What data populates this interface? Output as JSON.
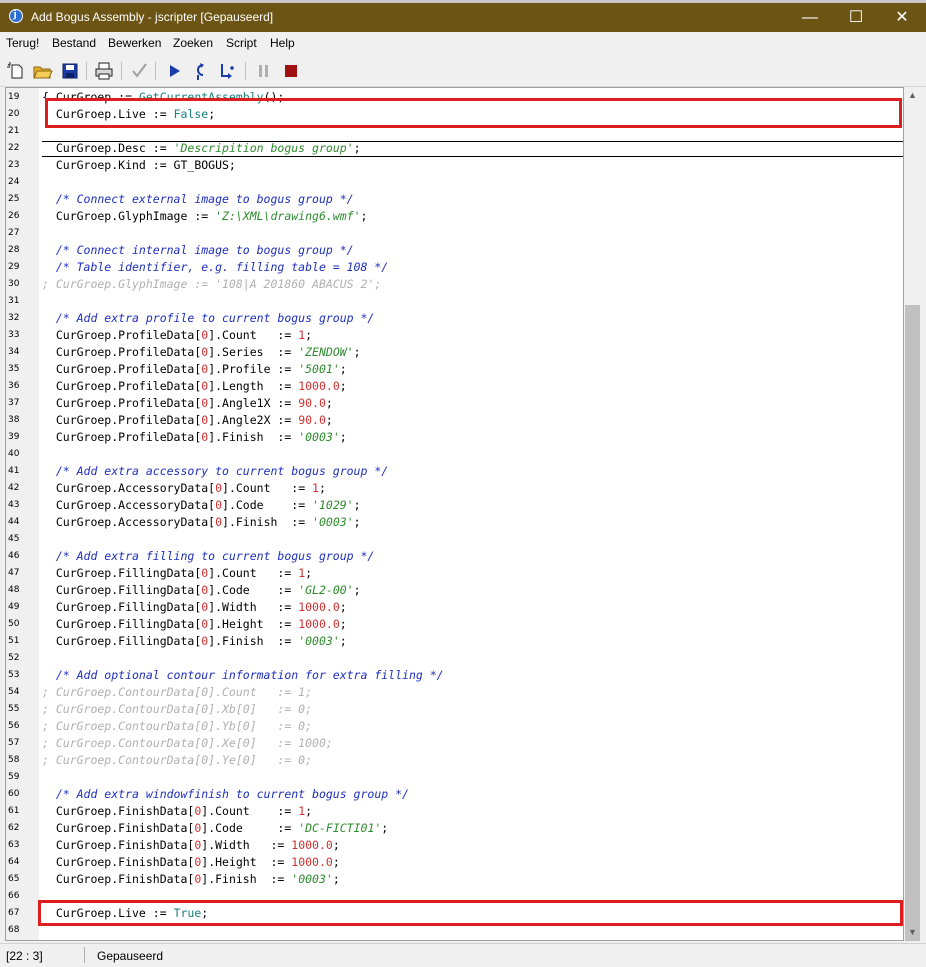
{
  "window": {
    "title": "Add Bogus Assembly - jscripter [Gepauseerd]",
    "minimize": "—",
    "maximize": "☐",
    "close": "✕"
  },
  "menu": [
    "Terug!",
    "Bestand",
    "Bewerken",
    "Zoeken",
    "Script",
    "Help"
  ],
  "toolbar": {
    "icons": [
      "new-file-icon",
      "open-folder-icon",
      "save-icon",
      "print-icon",
      "check-icon",
      "run-icon",
      "step-into-icon",
      "step-over-icon",
      "pause-icon",
      "stop-icon"
    ]
  },
  "editor": {
    "lines": [
      {
        "n": "19",
        "code": "{ CurGroep := GetCurrentAssembly();"
      },
      {
        "n": "20",
        "code": "  CurGroep.Live := False;"
      },
      {
        "n": "21",
        "code": ""
      },
      {
        "n": "22",
        "code": "  CurGroep.Desc := 'Descripition bogus group';"
      },
      {
        "n": "23",
        "code": "  CurGroep.Kind := GT_BOGUS;"
      },
      {
        "n": "24",
        "code": ""
      },
      {
        "n": "25",
        "code": "  /* Connect external image to bogus group */"
      },
      {
        "n": "26",
        "code": "  CurGroep.GlyphImage := 'Z:\\XML\\drawing6.wmf';"
      },
      {
        "n": "27",
        "code": ""
      },
      {
        "n": "28",
        "code": "  /* Connect internal image to bogus group */"
      },
      {
        "n": "29",
        "code": "  /* Table identifier, e.g. filling table = 108 */"
      },
      {
        "n": "30",
        "code": "; CurGroep.GlyphImage := '108|A 201860 ABACUS 2';"
      },
      {
        "n": "31",
        "code": ""
      },
      {
        "n": "32",
        "code": "  /* Add extra profile to current bogus group */"
      },
      {
        "n": "33",
        "code": "  CurGroep.ProfileData[0].Count   := 1;"
      },
      {
        "n": "34",
        "code": "  CurGroep.ProfileData[0].Series  := 'ZENDOW';"
      },
      {
        "n": "35",
        "code": "  CurGroep.ProfileData[0].Profile := '5001';"
      },
      {
        "n": "36",
        "code": "  CurGroep.ProfileData[0].Length  := 1000.0;"
      },
      {
        "n": "37",
        "code": "  CurGroep.ProfileData[0].Angle1X := 90.0;"
      },
      {
        "n": "38",
        "code": "  CurGroep.ProfileData[0].Angle2X := 90.0;"
      },
      {
        "n": "39",
        "code": "  CurGroep.ProfileData[0].Finish  := '0003';"
      },
      {
        "n": "40",
        "code": ""
      },
      {
        "n": "41",
        "code": "  /* Add extra accessory to current bogus group */"
      },
      {
        "n": "42",
        "code": "  CurGroep.AccessoryData[0].Count   := 1;"
      },
      {
        "n": "43",
        "code": "  CurGroep.AccessoryData[0].Code    := '1029';"
      },
      {
        "n": "44",
        "code": "  CurGroep.AccessoryData[0].Finish  := '0003';"
      },
      {
        "n": "45",
        "code": ""
      },
      {
        "n": "46",
        "code": "  /* Add extra filling to current bogus group */"
      },
      {
        "n": "47",
        "code": "  CurGroep.FillingData[0].Count   := 1;"
      },
      {
        "n": "48",
        "code": "  CurGroep.FillingData[0].Code    := 'GL2-00';"
      },
      {
        "n": "49",
        "code": "  CurGroep.FillingData[0].Width   := 1000.0;"
      },
      {
        "n": "50",
        "code": "  CurGroep.FillingData[0].Height  := 1000.0;"
      },
      {
        "n": "51",
        "code": "  CurGroep.FillingData[0].Finish  := '0003';"
      },
      {
        "n": "52",
        "code": ""
      },
      {
        "n": "53",
        "code": "  /* Add optional contour information for extra filling */"
      },
      {
        "n": "54",
        "code": "; CurGroep.ContourData[0].Count   := 1;"
      },
      {
        "n": "55",
        "code": "; CurGroep.ContourData[0].Xb[0]   := 0;"
      },
      {
        "n": "56",
        "code": "; CurGroep.ContourData[0].Yb[0]   := 0;"
      },
      {
        "n": "57",
        "code": "; CurGroep.ContourData[0].Xe[0]   := 1000;"
      },
      {
        "n": "58",
        "code": "; CurGroep.ContourData[0].Ye[0]   := 0;"
      },
      {
        "n": "59",
        "code": ""
      },
      {
        "n": "60",
        "code": "  /* Add extra windowfinish to current bogus group */"
      },
      {
        "n": "61",
        "code": "  CurGroep.FinishData[0].Count    := 1;"
      },
      {
        "n": "62",
        "code": "  CurGroep.FinishData[0].Code     := 'DC-FICTI01';"
      },
      {
        "n": "63",
        "code": "  CurGroep.FinishData[0].Width   := 1000.0;"
      },
      {
        "n": "64",
        "code": "  CurGroep.FinishData[0].Height  := 1000.0;"
      },
      {
        "n": "65",
        "code": "  CurGroep.FinishData[0].Finish  := '0003';"
      },
      {
        "n": "66",
        "code": ""
      },
      {
        "n": "67",
        "code": "  CurGroep.Live := True;"
      },
      {
        "n": "68",
        "code": ""
      }
    ]
  },
  "status": {
    "position": "[22 : 3]",
    "state": "Gepauseerd"
  }
}
